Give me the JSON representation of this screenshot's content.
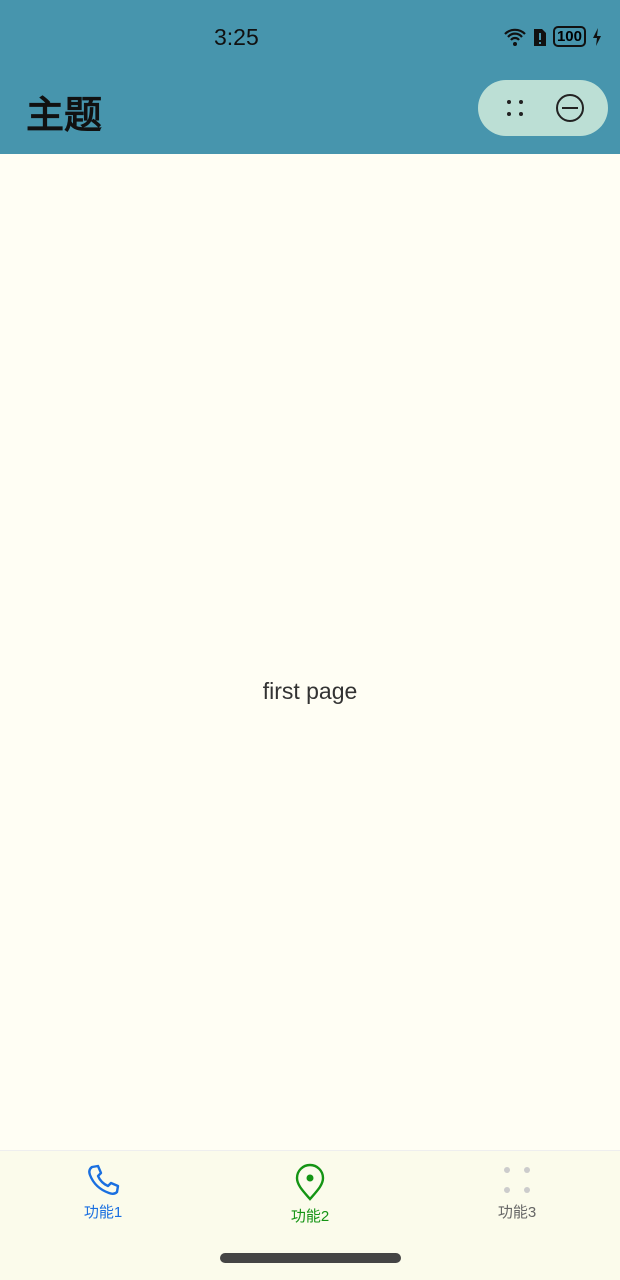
{
  "status_bar": {
    "time": "3:25",
    "battery": "100"
  },
  "header": {
    "title": "主题"
  },
  "main": {
    "text": "first page"
  },
  "tabs": [
    {
      "label": "功能1",
      "icon": "phone-icon",
      "color": "#1a6fe0"
    },
    {
      "label": "功能2",
      "icon": "location-pin-icon",
      "color": "#149414"
    },
    {
      "label": "功能3",
      "icon": "grid-dots-icon",
      "color": "#666666"
    }
  ]
}
